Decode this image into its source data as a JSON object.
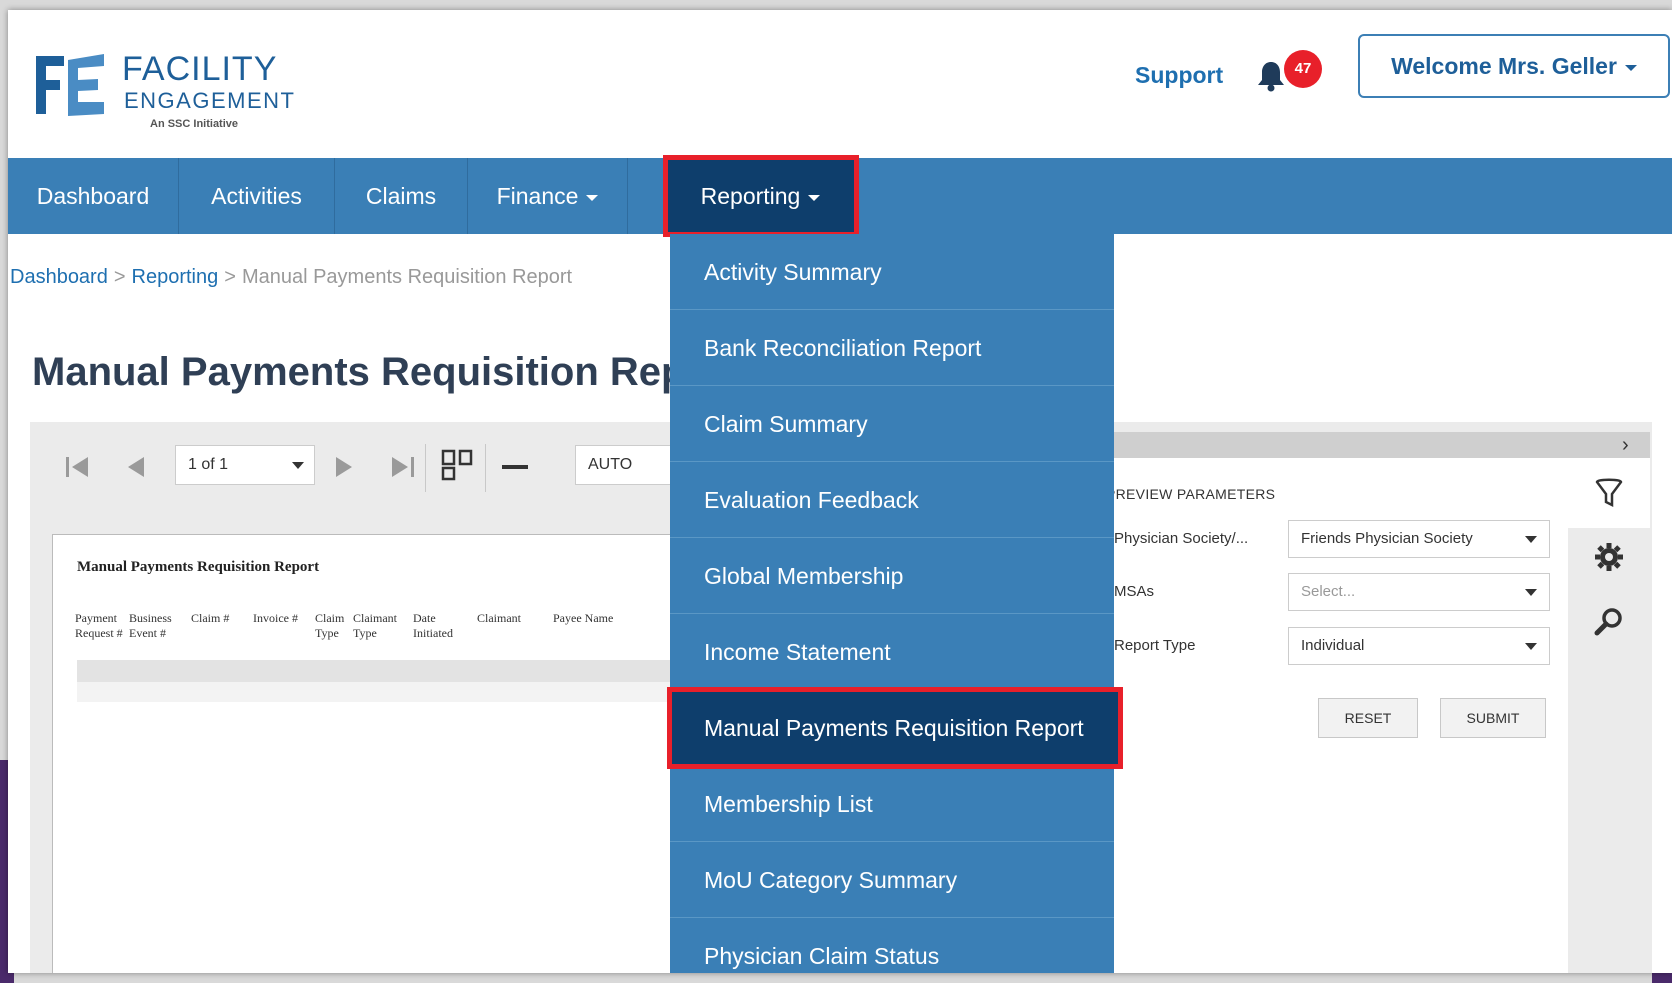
{
  "header": {
    "logo": {
      "line1": "FACILITY",
      "line2": "ENGAGEMENT",
      "tagline": "An SSC Initiative"
    },
    "support_label": "Support",
    "notification_count": "47",
    "welcome_label": "Welcome Mrs. Geller"
  },
  "nav": {
    "items": [
      {
        "label": "Dashboard"
      },
      {
        "label": "Activities"
      },
      {
        "label": "Claims"
      },
      {
        "label": "Finance"
      },
      {
        "label": "Reporting"
      }
    ]
  },
  "breadcrumb": {
    "items": [
      "Dashboard",
      "Reporting"
    ],
    "separator": ">",
    "current": "Manual Payments Requisition Report"
  },
  "page": {
    "title": "Manual Payments Requisition Report"
  },
  "viewer": {
    "page_indicator": "1 of 1",
    "zoom": "AUTO",
    "report_title": "Manual Payments Requisition Report",
    "columns": [
      "Payment Request #",
      "Business Event #",
      "Claim #",
      "Invoice #",
      "Claim Type",
      "Claimant Type",
      "Date Initiated",
      "Claimant",
      "Payee Name"
    ]
  },
  "parameters": {
    "heading": "PREVIEW PARAMETERS",
    "fields": [
      {
        "label": "Physician Society/...",
        "value": "Friends Physician Society"
      },
      {
        "label": "MSAs",
        "placeholder": "Select..."
      },
      {
        "label": "Report Type",
        "value": "Individual"
      }
    ],
    "reset_label": "RESET",
    "submit_label": "SUBMIT"
  },
  "reporting_menu": {
    "items": [
      "Activity Summary",
      "Bank Reconciliation Report",
      "Claim Summary",
      "Evaluation Feedback",
      "Global Membership",
      "Income Statement",
      "Manual Payments Requisition Report",
      "Membership List",
      "MoU Category Summary",
      "Physician Claim Status"
    ],
    "active": "Manual Payments Requisition Report"
  },
  "colors": {
    "nav_blue": "#3a7fb6",
    "nav_active": "#0e3e6c",
    "highlight_red": "#e8202a",
    "link_blue": "#1e6fb0",
    "badge_red": "#e8202a"
  }
}
